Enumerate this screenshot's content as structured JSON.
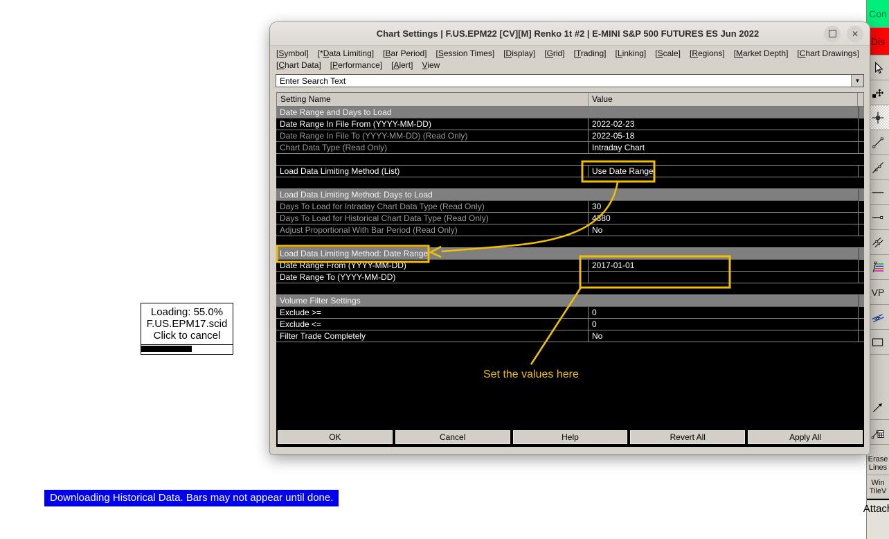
{
  "window": {
    "title": "Chart Settings | F.US.EPM22 [CV][M]  Renko 1t  #2 | E-MINI S&P 500 FUTURES ES Jun 2022",
    "maximize_icon": "maximize-square",
    "close_icon": "✕"
  },
  "menu": {
    "row1": [
      {
        "text": "[Symbol]",
        "u": 1
      },
      {
        "text": "[*Data Limiting]",
        "u": 2
      },
      {
        "text": "[Bar Period]",
        "u": 1
      },
      {
        "text": "[Session Times]",
        "u": 1
      },
      {
        "text": "[Display]",
        "u": 1
      },
      {
        "text": "[Grid]",
        "u": 1
      },
      {
        "text": "[Trading]",
        "u": 1
      },
      {
        "text": "[Linking]",
        "u": 1
      },
      {
        "text": "[Scale]",
        "u": 1
      },
      {
        "text": "[Regions]",
        "u": 1
      },
      {
        "text": "[Market Depth]",
        "u": 1
      },
      {
        "text": "[Chart Drawings]",
        "u": 1
      }
    ],
    "row2": [
      {
        "text": "[Chart Data]",
        "u": 1
      },
      {
        "text": "[Performance]",
        "u": 1
      },
      {
        "text": "[Alert]",
        "u": 1
      },
      {
        "text": "View",
        "u": 0
      }
    ]
  },
  "search": {
    "value": "Enter Search Text",
    "dropdown_icon": "▼"
  },
  "table": {
    "columns": [
      "Setting Name",
      "Value"
    ],
    "rows": [
      {
        "type": "section",
        "label": "Date Range and Days to Load"
      },
      {
        "type": "row",
        "label": "Date Range In File From (YYYY-MM-DD)",
        "value": "2022-02-23",
        "readonly": false
      },
      {
        "type": "row",
        "label": "Date Range In File To (YYYY-MM-DD) (Read Only)",
        "value": "2022-05-18",
        "readonly": true
      },
      {
        "type": "row",
        "label": "Chart Data Type (Read Only)",
        "value": "Intraday Chart",
        "readonly": true
      },
      {
        "type": "spacer"
      },
      {
        "type": "row",
        "label": "Load Data Limiting Method (List)",
        "value": "Use Date Range",
        "readonly": false
      },
      {
        "type": "spacer"
      },
      {
        "type": "section",
        "label": "Load Data Limiting Method: Days to Load"
      },
      {
        "type": "row",
        "label": "Days To Load for Intraday Chart Data Type (Read Only)",
        "value": "30",
        "readonly": true
      },
      {
        "type": "row",
        "label": "Days To Load for Historical Chart Data Type (Read Only)",
        "value": "4380",
        "readonly": true
      },
      {
        "type": "row",
        "label": "Adjust Proportional With Bar Period (Read Only)",
        "value": "No",
        "readonly": true
      },
      {
        "type": "spacer"
      },
      {
        "type": "section",
        "label": "Load Data Limiting Method: Date Range"
      },
      {
        "type": "row",
        "label": "Date Range From (YYYY-MM-DD)",
        "value": "2017-01-01",
        "readonly": false
      },
      {
        "type": "row",
        "label": "Date Range To (YYYY-MM-DD)",
        "value": "",
        "readonly": false
      },
      {
        "type": "spacer"
      },
      {
        "type": "section",
        "label": "Volume Filter Settings"
      },
      {
        "type": "row",
        "label": "Exclude >=",
        "value": "0",
        "readonly": false
      },
      {
        "type": "row",
        "label": "Exclude <=",
        "value": "0",
        "readonly": false
      },
      {
        "type": "row",
        "label": "Filter Trade Completely",
        "value": "No",
        "readonly": false
      }
    ]
  },
  "dialog_buttons": [
    "OK",
    "Cancel",
    "Help",
    "Revert All",
    "Apply All"
  ],
  "annotations": {
    "note": "Set the values here"
  },
  "loading": {
    "line1": "Loading: 55.0%",
    "line2": "F.US.EPM17.scid",
    "line3": "Click to cancel",
    "progress_pct": 55
  },
  "status_banner": "Downloading Historical Data. Bars may not appear until done.",
  "toolbar": {
    "connect_label": "Con",
    "disconnect_label": "Dis",
    "vp_label": "VP",
    "erase_lines": [
      "Erase",
      "Lines"
    ],
    "win_tile": [
      "Win",
      "TileV"
    ],
    "attach_label": "Attach",
    "icons": [
      "pointer-icon",
      "hand-move-icon",
      "crosshair-icon",
      "trendline-icon",
      "extended-line-icon",
      "horizontal-line-icon",
      "horizontal-ray-icon",
      "parallel-lines-icon",
      "fibonacci-icon",
      "channel-icon",
      "rectangle-icon",
      "arrow-line-icon",
      "measure-calculator-icon"
    ]
  },
  "colors": {
    "annotation": "#F0C000",
    "banner_bg": "#0000F0",
    "connect_bg": "#00EF7B",
    "disconnect_bg": "#FB0505",
    "section_bg": "#7F7F7F",
    "row_bg": "#000000"
  }
}
